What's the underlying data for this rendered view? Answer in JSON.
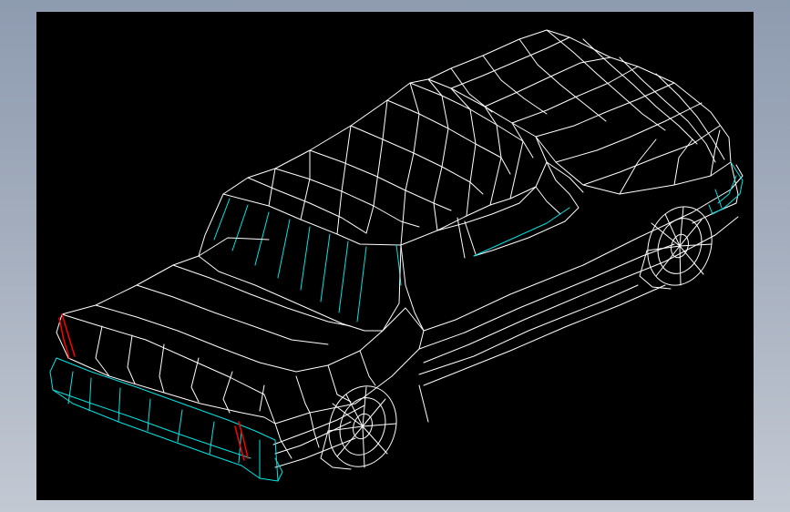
{
  "viewport": {
    "background": "#000000",
    "frame_gradient": [
      "#8e9bb0",
      "#c3c9d3"
    ],
    "model_description_colors": {
      "body_lines": "#ffffff",
      "accent_lines": "#00e5e5",
      "tail_lights": "#ff0000"
    },
    "model_icon": "car-wireframe-icon"
  }
}
